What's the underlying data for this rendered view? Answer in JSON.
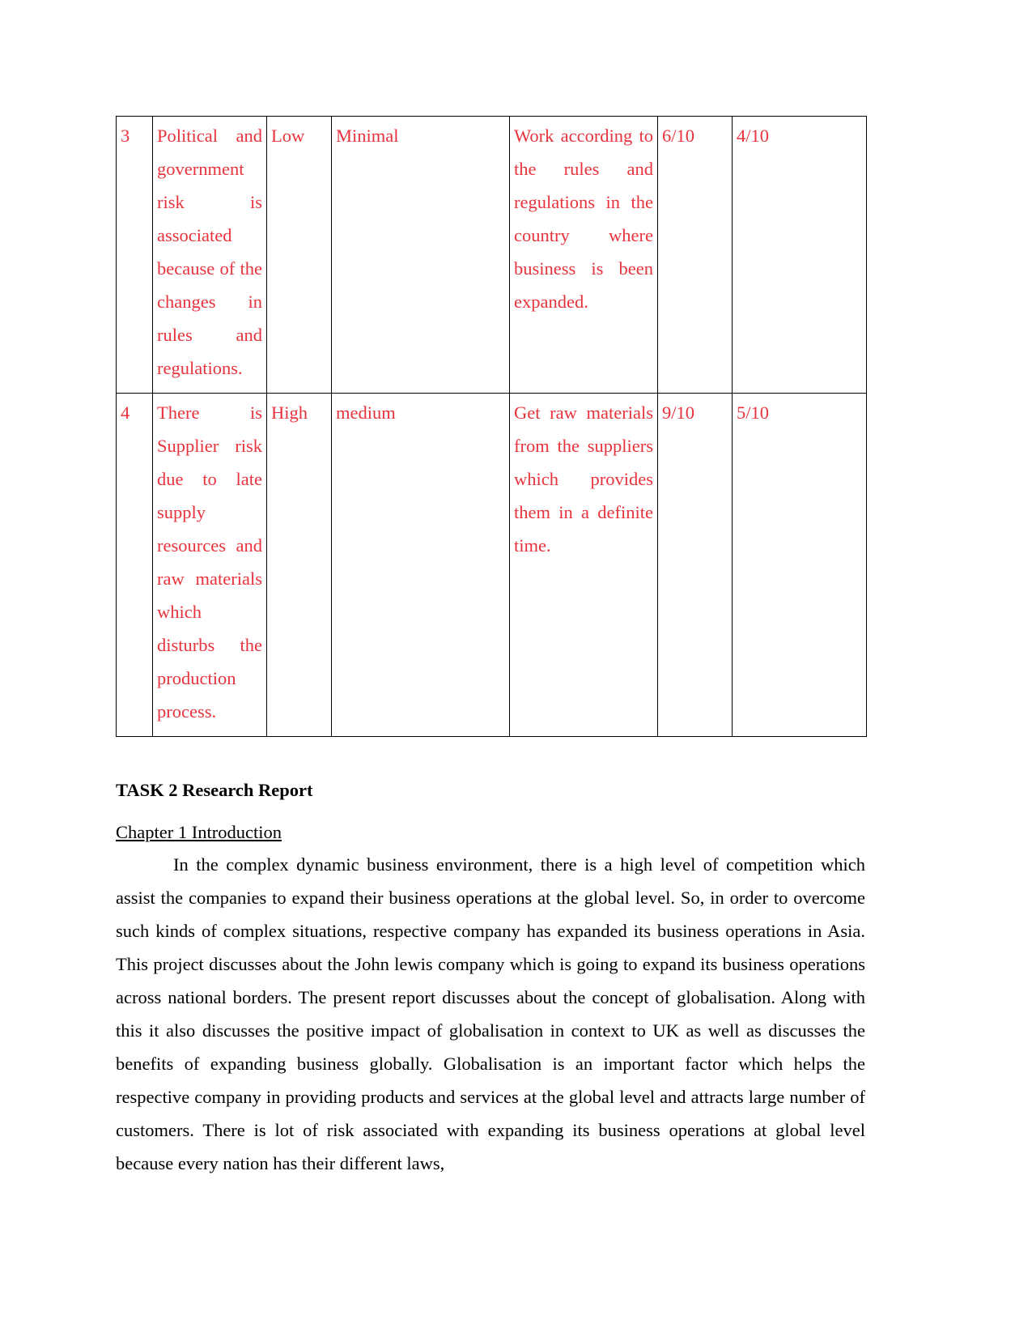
{
  "risk_table": {
    "rows": [
      {
        "no": "3",
        "risk": "Political and government risk is associated because of the changes in rules and regulations.",
        "likelihood": "Low",
        "impact": "Minimal",
        "mitigation": "Work according to the rules and regulations in the country where business is been expanded.",
        "score_before": "6/10",
        "score_after": "4/10"
      },
      {
        "no": "4",
        "risk": "There is Supplier risk due to late supply resources and raw materials which disturbs the production process.",
        "likelihood": "High",
        "impact": "medium",
        "mitigation": "Get raw materials from the suppliers which provides them in a definite time.",
        "score_before": "9/10",
        "score_after": "5/10"
      }
    ],
    "text_color": "#e8333c"
  },
  "task_heading": "TASK 2 Research Report",
  "chapter_title": "Chapter 1 Introduction",
  "intro_paragraph": "In the complex dynamic business environment, there is a high level of competition which assist the companies to expand their business operations at the global level. So, in order to overcome such kinds of complex situations, respective company has expanded its business operations in Asia. This project discusses about the John lewis company which is going to expand its business operations across national borders. The present report discusses about the concept of globalisation. Along with this it also discusses the positive impact of globalisation in context to UK as well as discusses the benefits of expanding business globally. Globalisation is an important factor which helps the respective company in providing products and services at the global level and attracts large number of customers. There is lot of risk associated with expanding its business operations at global level because every nation has their different laws,"
}
